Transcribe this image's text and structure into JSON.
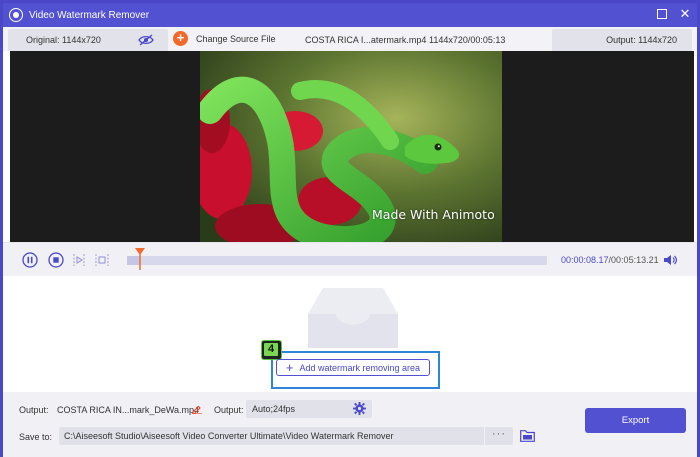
{
  "window": {
    "title": "Video Watermark Remover"
  },
  "info_bar": {
    "original": "Original: 1144x720",
    "change_source": "Change Source File",
    "file_name": "COSTA RICA I...atermark.mp4",
    "file_meta": "1144x720/00:05:13",
    "output": "Output: 1144x720"
  },
  "preview": {
    "watermark_text": "Made With Animoto"
  },
  "playback": {
    "current_time": "00:00:08.17",
    "total_time": "/00:05:13.21",
    "progress": 0.03
  },
  "main": {
    "step_badge": "4",
    "add_area_label": "Add watermark removing area"
  },
  "bottom": {
    "output_label": "Output:",
    "output_file": "COSTA RICA IN...mark_DeWa.mp4",
    "format_label": "Output:",
    "format_value": "Auto;24fps",
    "save_label": "Save to:",
    "save_path": "C:\\Aiseesoft Studio\\Aiseesoft Video Converter Ultimate\\Video Watermark Remover",
    "more_label": "···",
    "export_label": "Export"
  },
  "colors": {
    "accent": "#5251d2",
    "time_highlight": "#4a49c9",
    "highlight_box": "#2d87d6",
    "badge": "#7bd650",
    "change_source_icon": "#f26a2b"
  }
}
